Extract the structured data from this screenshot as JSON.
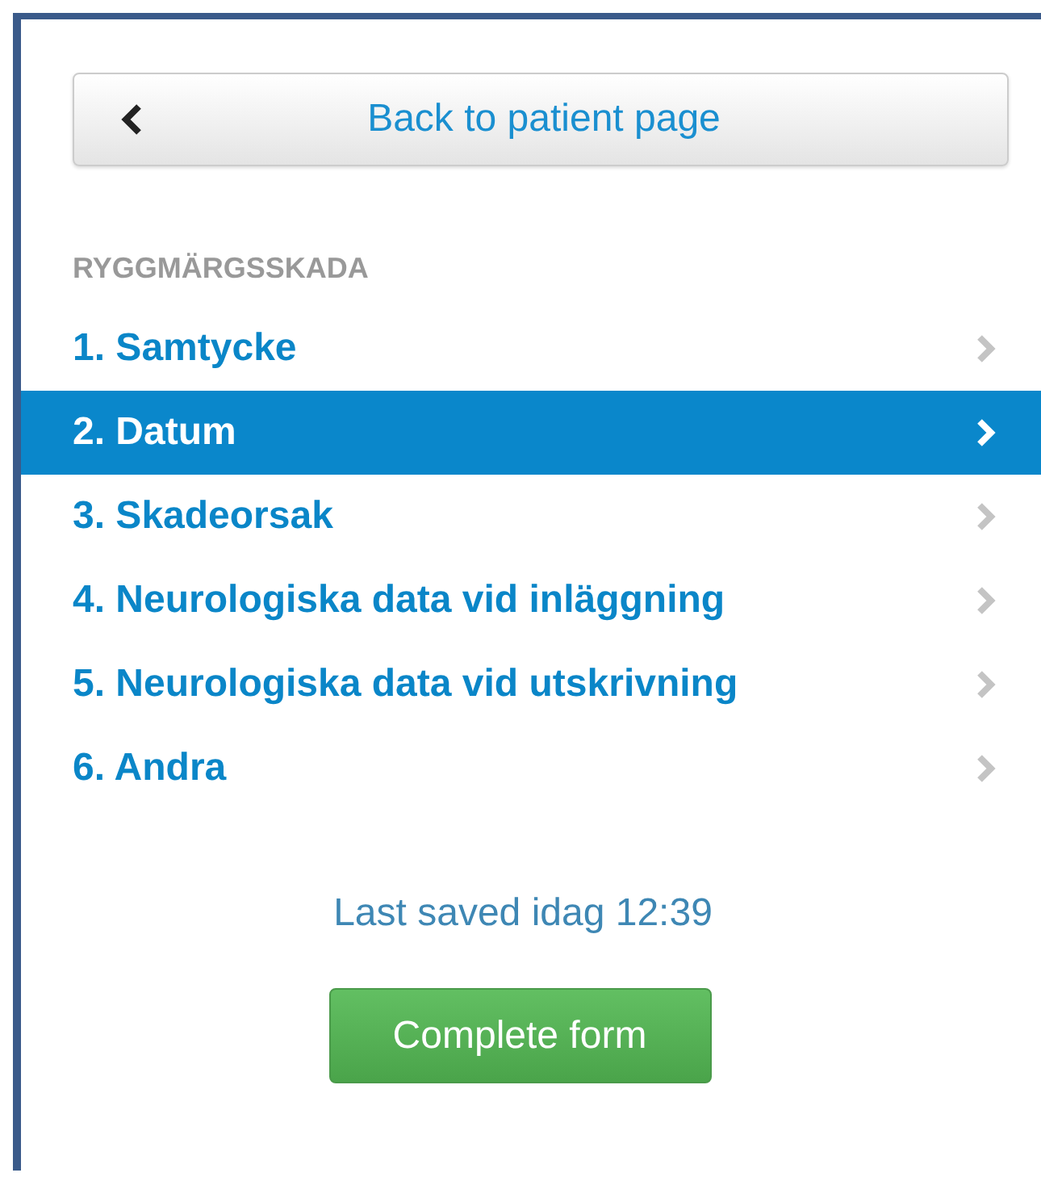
{
  "back_button": {
    "label": "Back to patient page"
  },
  "section": {
    "title": "RYGGMÄRGSSKADA"
  },
  "items": [
    {
      "label": "1. Samtycke",
      "selected": false
    },
    {
      "label": "2. Datum",
      "selected": true
    },
    {
      "label": "3. Skadeorsak",
      "selected": false
    },
    {
      "label": "4. Neurologiska data vid inläggning",
      "selected": false
    },
    {
      "label": "5. Neurologiska data vid utskrivning",
      "selected": false
    },
    {
      "label": "6. Andra",
      "selected": false
    }
  ],
  "last_saved": "Last saved idag 12:39",
  "complete_button": {
    "label": "Complete form"
  }
}
